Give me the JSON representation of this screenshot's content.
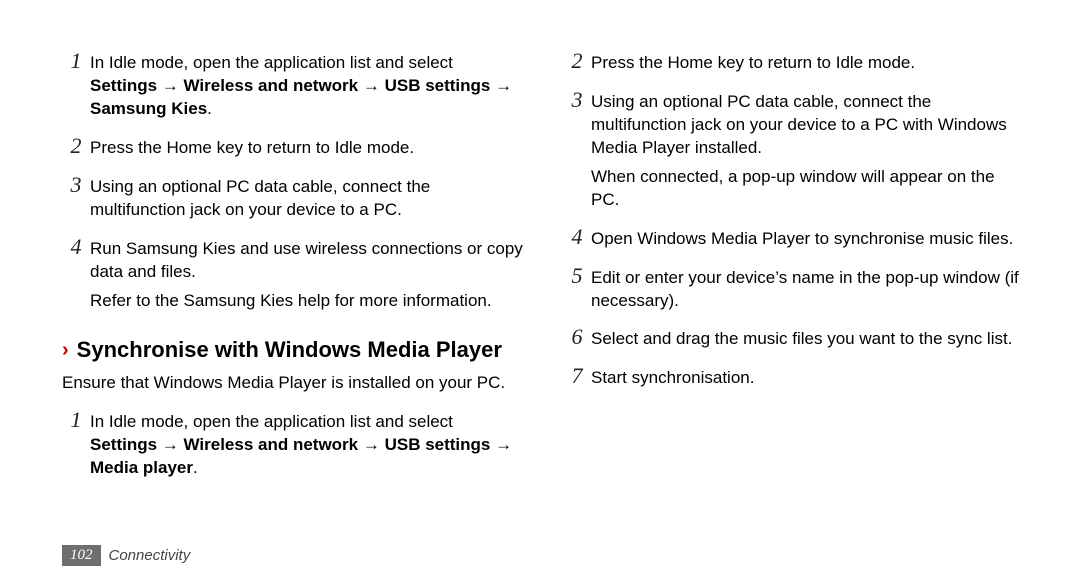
{
  "left": {
    "steps_a": [
      {
        "num": "1",
        "text": "In Idle mode, open the application list and select ",
        "bold": "Settings → Wireless and network → USB settings → Samsung Kies",
        "tail": "."
      },
      {
        "num": "2",
        "text": "Press the Home key to return to Idle mode."
      },
      {
        "num": "3",
        "text": "Using an optional PC data cable, connect the multifunction jack on your device to a PC."
      },
      {
        "num": "4",
        "text": "Run Samsung Kies and use wireless connections or copy data and files.",
        "extra": "Refer to the Samsung Kies help for more information."
      }
    ],
    "heading": "Synchronise with Windows Media Player",
    "intro": "Ensure that Windows Media Player is installed on your PC.",
    "steps_b": [
      {
        "num": "1",
        "text": "In Idle mode, open the application list and select ",
        "bold": "Settings → Wireless and network → USB settings → Media player",
        "tail": "."
      }
    ]
  },
  "right": {
    "steps": [
      {
        "num": "2",
        "text": "Press the Home key to return to Idle mode."
      },
      {
        "num": "3",
        "text": "Using an optional PC data cable, connect the multifunction jack on your device to a PC with Windows Media Player installed.",
        "extra": "When connected, a pop-up window will appear on the PC."
      },
      {
        "num": "4",
        "text": "Open Windows Media Player to synchronise music files."
      },
      {
        "num": "5",
        "text": "Edit or enter your device’s name in the pop-up window (if necessary)."
      },
      {
        "num": "6",
        "text": "Select and drag the music files you want to the sync list."
      },
      {
        "num": "7",
        "text": "Start synchronisation."
      }
    ]
  },
  "footer": {
    "page": "102",
    "chapter": "Connectivity"
  }
}
